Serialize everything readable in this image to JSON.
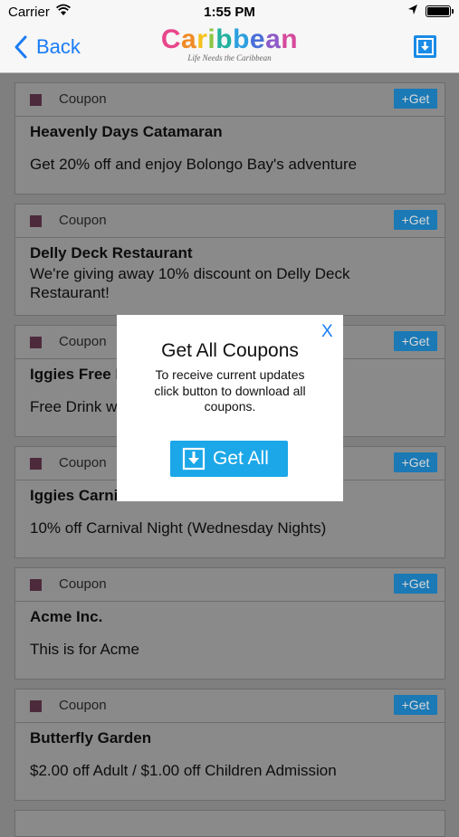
{
  "status": {
    "carrier": "Carrier",
    "time": "1:55 PM"
  },
  "nav": {
    "back_label": "Back",
    "logo_word": "Caribbean",
    "logo_tagline": "Life Needs the Caribbean",
    "logo_colors": [
      "#e8478b",
      "#f08a24",
      "#f5c21b",
      "#8bc540",
      "#22b0a0",
      "#2d9fe0",
      "#4a6fd8",
      "#8e5bc9",
      "#d64a9c"
    ]
  },
  "coupons": [
    {
      "type": "Coupon",
      "get_label": "+Get",
      "title": "Heavenly Days Catamaran",
      "description": "Get 20% off and enjoy Bolongo Bay's adventure"
    },
    {
      "type": "Coupon",
      "get_label": "+Get",
      "title": "Delly Deck Restaurant",
      "description": "We're giving away 10% discount on Delly Deck Restaurant!"
    },
    {
      "type": "Coupon",
      "get_label": "+Get",
      "title": "Iggies Free D",
      "description": "Free Drink w"
    },
    {
      "type": "Coupon",
      "get_label": "+Get",
      "title": "Iggies Carniv",
      "description": "10% off Carnival Night (Wednesday Nights)"
    },
    {
      "type": "Coupon",
      "get_label": "+Get",
      "title": "Acme Inc.",
      "description": "This is for Acme"
    },
    {
      "type": "Coupon",
      "get_label": "+Get",
      "title": "Butterfly Garden",
      "description": "$2.00 off Adult / $1.00 off Children Admission"
    }
  ],
  "modal": {
    "close_label": "X",
    "title": "Get All Coupons",
    "text": "To receive current updates click button to download all coupons.",
    "button_label": "Get All"
  },
  "colors": {
    "accent": "#1a7cf4",
    "button_blue": "#1ba7e8",
    "overlay_gray": "#7f7f7f"
  }
}
